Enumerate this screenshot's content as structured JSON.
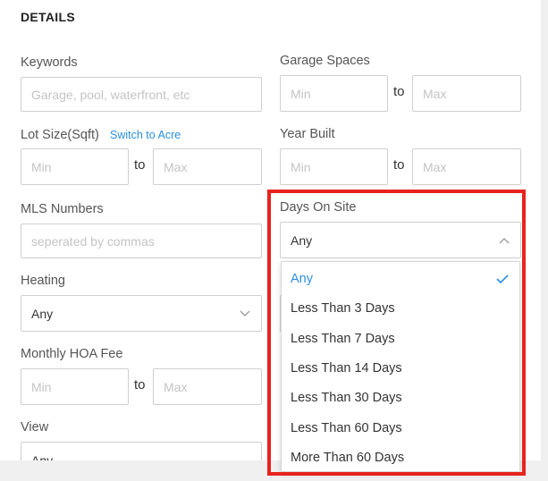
{
  "section": {
    "title": "DETAILS"
  },
  "keywords": {
    "label": "Keywords",
    "placeholder": "Garage, pool, waterfront, etc"
  },
  "garage_spaces": {
    "label": "Garage Spaces",
    "min_placeholder": "Min",
    "max_placeholder": "Max",
    "to": "to"
  },
  "lot_size": {
    "label": "Lot Size(Sqft)",
    "switch_link": "Switch to Acre",
    "min_placeholder": "Min",
    "max_placeholder": "Max",
    "to": "to"
  },
  "year_built": {
    "label": "Year Built",
    "min_placeholder": "Min",
    "max_placeholder": "Max",
    "to": "to"
  },
  "mls_numbers": {
    "label": "MLS Numbers",
    "placeholder": "seperated by commas"
  },
  "days_on_site": {
    "label": "Days On Site",
    "value": "Any",
    "options": [
      {
        "label": "Any",
        "selected": true
      },
      {
        "label": "Less Than 3 Days",
        "selected": false
      },
      {
        "label": "Less Than 7 Days",
        "selected": false
      },
      {
        "label": "Less Than 14 Days",
        "selected": false
      },
      {
        "label": "Less Than 30 Days",
        "selected": false
      },
      {
        "label": "Less Than 60 Days",
        "selected": false
      },
      {
        "label": "More Than 60 Days",
        "selected": false
      }
    ]
  },
  "heating": {
    "label": "Heating",
    "value": "Any"
  },
  "monthly_hoa_fee": {
    "label": "Monthly HOA Fee",
    "min_placeholder": "Min",
    "max_placeholder": "Max",
    "to": "to"
  },
  "view": {
    "label": "View",
    "value": "Any"
  },
  "colors": {
    "accent": "#2b8fe0",
    "highlight": "#e8231f"
  },
  "icons": {
    "chevron_down": "chevron-down-icon",
    "chevron_up": "chevron-up-icon",
    "check": "check-icon"
  }
}
